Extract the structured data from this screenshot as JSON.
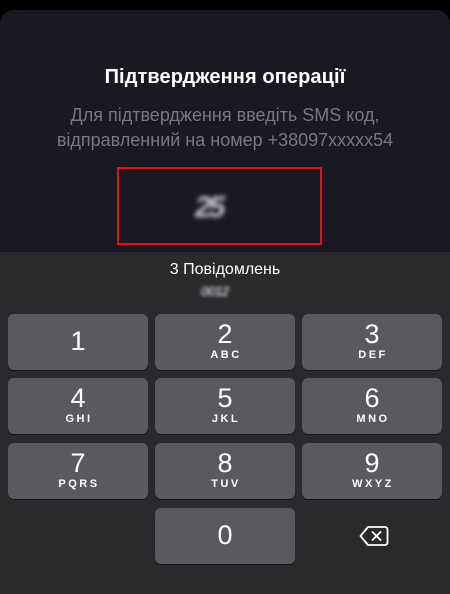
{
  "sheet": {
    "title": "Підтвердження операції",
    "subtitle": "Для підтвердження введіть SMS код, відправленний на номер +38097xxxxx54",
    "code_box_border_color": "#e0141c",
    "code_blurred": "25"
  },
  "keyboard": {
    "suggestion": "3 Повідомлень",
    "suggestion_blurred": "0012",
    "keys": [
      {
        "digit": "1",
        "letters": ""
      },
      {
        "digit": "2",
        "letters": "ABC"
      },
      {
        "digit": "3",
        "letters": "DEF"
      },
      {
        "digit": "4",
        "letters": "GHI"
      },
      {
        "digit": "5",
        "letters": "JKL"
      },
      {
        "digit": "6",
        "letters": "MNO"
      },
      {
        "digit": "7",
        "letters": "PQRS"
      },
      {
        "digit": "8",
        "letters": "TUV"
      },
      {
        "digit": "9",
        "letters": "WXYZ"
      },
      {
        "digit": "0",
        "letters": ""
      }
    ],
    "delete_icon": "backspace-icon"
  }
}
